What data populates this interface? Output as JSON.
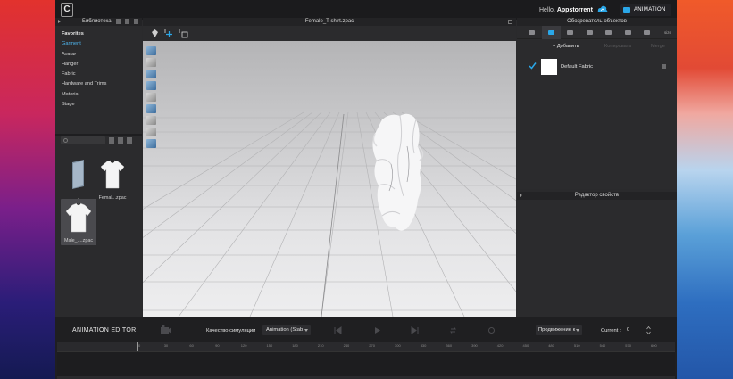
{
  "app": {
    "logo_letter": "C",
    "greeting": "Hello, ",
    "username": "Appstorrent",
    "mode_label": "ANIMATION"
  },
  "library": {
    "header": "Библиотека",
    "tree": [
      {
        "label": "Favorites",
        "style": "fav"
      },
      {
        "label": "Garment",
        "style": "sel"
      },
      {
        "label": "Avatar",
        "style": ""
      },
      {
        "label": "Hanger",
        "style": ""
      },
      {
        "label": "Fabric",
        "style": ""
      },
      {
        "label": "Hardware and Trims",
        "style": ""
      },
      {
        "label": "Material",
        "style": ""
      },
      {
        "label": "Stage",
        "style": ""
      }
    ],
    "files": [
      {
        "name": "..",
        "kind": "folder"
      },
      {
        "name": "Femal...zpac",
        "kind": "shirt"
      },
      {
        "name": "Male_....zpac",
        "kind": "shirt"
      }
    ]
  },
  "viewport": {
    "file_title": "Female_T-shirt.zpac"
  },
  "object_browser": {
    "header": "Обозреватель объектов",
    "add_label": "Добавить",
    "copy_label": "Копировать",
    "merge_label": "Merge",
    "size_label": "size",
    "fabrics": [
      {
        "name": "Default Fabric",
        "color": "#ffffff",
        "checked": true
      }
    ]
  },
  "property_editor": {
    "header": "Редактор свойств"
  },
  "animation_editor": {
    "title": "ANIMATION EDITOR",
    "sim_quality_label": "Качество симуляции",
    "sim_quality_value": "Animation (Stab",
    "movement_value": "Продвижение к",
    "current_label": "Current :",
    "current_value": "0",
    "ruler_ticks": [
      "0",
      "30",
      "60",
      "90",
      "120",
      "150",
      "180",
      "210",
      "240",
      "270",
      "300",
      "330",
      "360",
      "390",
      "420",
      "450",
      "480",
      "510",
      "540",
      "570",
      "600"
    ]
  },
  "colors": {
    "accent": "#2aa7e8",
    "selected_tree": "#4fb6ef"
  }
}
